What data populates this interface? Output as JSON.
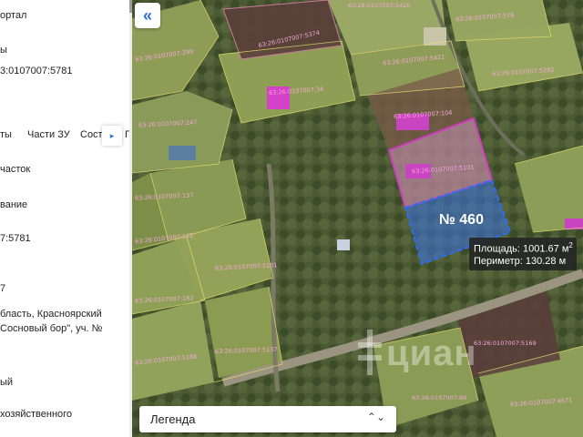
{
  "panel": {
    "portal_fragment": "ортал",
    "link_fragment": "ы",
    "cadastral_number_fragment": "3:0107007:5781",
    "tabs": [
      "ты",
      "Части ЗУ",
      "Соста",
      "Г"
    ],
    "fields": [
      {
        "text": "часток"
      },
      {
        "text": "вание"
      },
      {
        "text": "7:5781"
      },
      {
        "text": "7"
      },
      {
        "text": "бласть, Красноярский"
      },
      {
        "text": "Сосновый бор\", уч. №"
      },
      {
        "text": "ый"
      },
      {
        "text": "хозяйственного"
      }
    ]
  },
  "map": {
    "collapse_icon": "«",
    "selected_plot": {
      "label": "№ 460",
      "fill": "#3c6fd7",
      "area_label": "Площадь: 1001.67 м",
      "area_unit_sup": "2",
      "perimeter_label": "Периметр: 130.28 м"
    },
    "legend": {
      "label": "Легенда",
      "chevron": "⌃⌄"
    },
    "watermark": "циан",
    "parcel_labels": [
      {
        "text": "63:26:0107007:5374"
      },
      {
        "text": "63:26:0107007:5420"
      },
      {
        "text": "63:26:0107007:578"
      },
      {
        "text": "63:26:0107007:299"
      },
      {
        "text": "63:26:0107007:5421"
      },
      {
        "text": "63:26:0107007:5292"
      },
      {
        "text": "63:26:0107007:34"
      },
      {
        "text": "63:26:0107007:247"
      },
      {
        "text": "63:26:0107007:104"
      },
      {
        "text": "63:26:0107007:5101"
      },
      {
        "text": "63:26:0107007:137"
      },
      {
        "text": "63:26:0107007:122"
      },
      {
        "text": "63:26:0107007:5101"
      },
      {
        "text": "63:26:0107007:182"
      },
      {
        "text": "63:26:0107007:5186"
      },
      {
        "text": "63:26:0107007:5137"
      },
      {
        "text": "63:26:0107007:5169"
      },
      {
        "text": "63:26:0107007:80"
      },
      {
        "text": "63:26:0107007:4671"
      }
    ]
  }
}
